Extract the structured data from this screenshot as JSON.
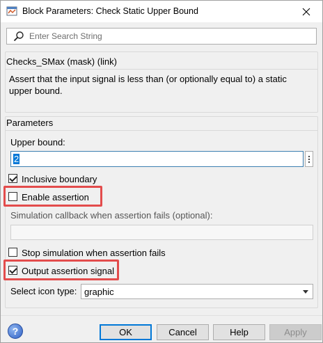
{
  "window": {
    "title": "Block Parameters: Check Static Upper Bound"
  },
  "search": {
    "placeholder": "Enter Search String",
    "value": ""
  },
  "mask": {
    "header": "Checks_SMax (mask) (link)",
    "description": "Assert that the input signal is less than (or optionally equal to) a static upper bound."
  },
  "parameters": {
    "header": "Parameters",
    "upper_bound_label": "Upper bound:",
    "upper_bound_value": "2",
    "inclusive_boundary": {
      "label": "Inclusive boundary",
      "checked": true
    },
    "enable_assertion": {
      "label": "Enable assertion",
      "checked": false
    },
    "callback_label": "Simulation callback when assertion fails (optional):",
    "callback_value": "",
    "stop_simulation": {
      "label": "Stop simulation when assertion fails",
      "checked": false
    },
    "output_assertion": {
      "label": "Output assertion signal",
      "checked": true
    },
    "icon_type_label": "Select icon type:",
    "icon_type_value": "graphic"
  },
  "footer": {
    "ok": "OK",
    "cancel": "Cancel",
    "help": "Help",
    "apply": "Apply"
  },
  "colors": {
    "highlight": "#e34c4c",
    "accent": "#0078d7"
  }
}
